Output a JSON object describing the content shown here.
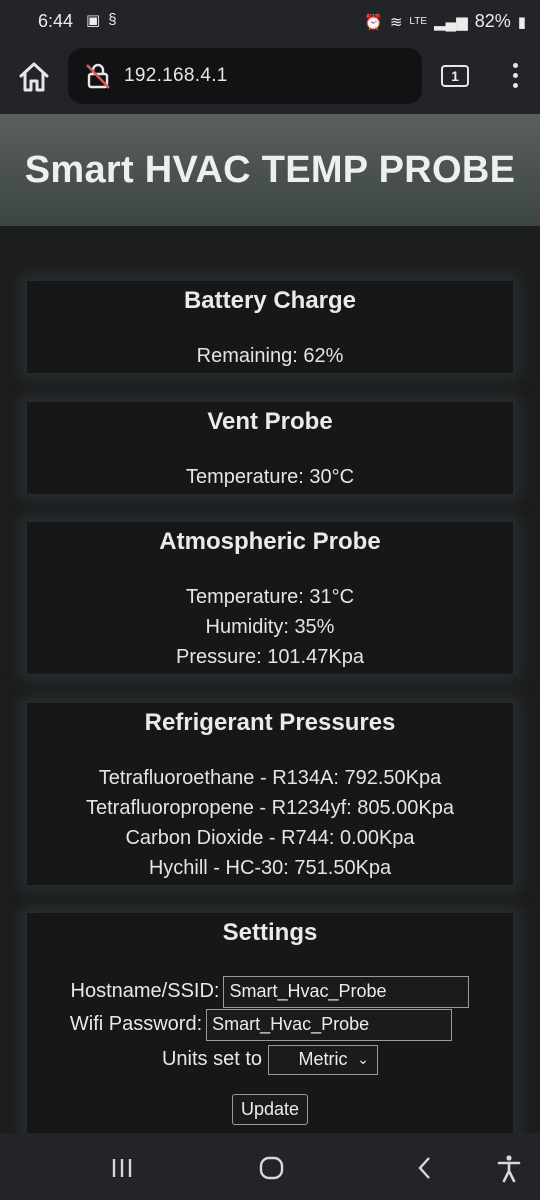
{
  "status_bar": {
    "time": "6:44",
    "battery": "82%",
    "icons": [
      "sim-icon",
      "vpn-icon",
      "alarm-icon",
      "wifi-icon",
      "volte-icon",
      "signal-icon",
      "battery-icon"
    ]
  },
  "browser": {
    "url": "192.168.4.1",
    "tab_count": "1"
  },
  "page": {
    "title": "Smart HVAC TEMP PROBE"
  },
  "battery": {
    "heading": "Battery Charge",
    "lines": [
      "Remaining: 62%"
    ]
  },
  "vent": {
    "heading": "Vent Probe",
    "lines": [
      "Temperature: 30°C"
    ]
  },
  "atmo": {
    "heading": "Atmospheric Probe",
    "lines": [
      "Temperature: 31°C",
      "Humidity: 35%",
      "Pressure: 101.47Kpa"
    ]
  },
  "refrig": {
    "heading": "Refrigerant Pressures",
    "lines": [
      "Tetrafluoroethane - R134A: 792.50Kpa",
      "Tetrafluoropropene - R1234yf: 805.00Kpa",
      "Carbon Dioxide - R744: 0.00Kpa",
      "Hychill - HC-30: 751.50Kpa"
    ]
  },
  "settings": {
    "heading": "Settings",
    "hostname_label": "Hostname/SSID:",
    "hostname_value": "Smart_Hvac_Probe",
    "password_label": "Wifi Password:",
    "password_value": "Smart_Hvac_Probe",
    "units_label": "Units set to",
    "units_value": "Metric",
    "update_label": "Update"
  }
}
